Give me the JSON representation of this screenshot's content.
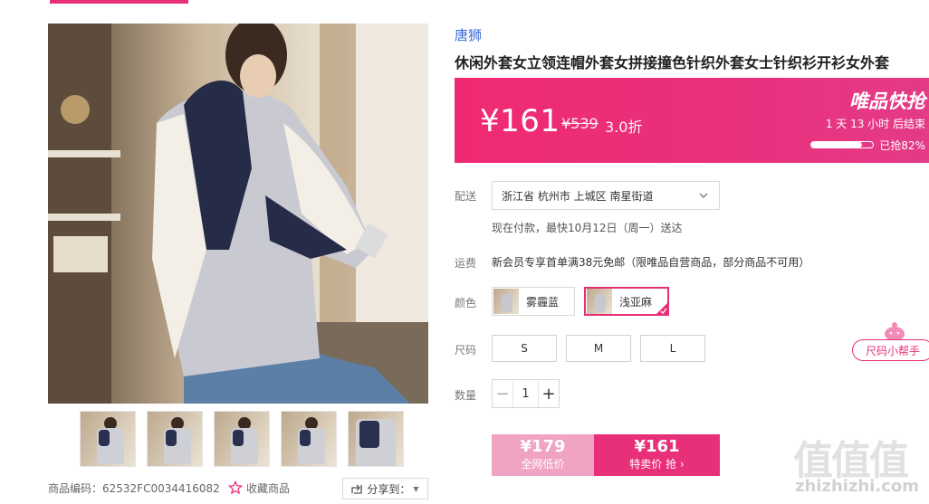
{
  "brand": "唐狮",
  "title": "休闲外套女立领连帽外套女拼接撞色针织外套女士针织衫开衫女外套",
  "price": {
    "current": "¥161",
    "original": "¥539",
    "discount": "3.0折",
    "promo_label": "唯品快抢",
    "countdown": "1 天 13 小时 后结束",
    "sold_label": "已抢82%",
    "sold_fraction": 0.82
  },
  "delivery": {
    "label": "配送",
    "address": "浙江省 杭州市 上城区 南星街道",
    "note": "现在付款，最快10月12日（周一）送达"
  },
  "freight": {
    "label": "运费",
    "text": "新会员专享首单满38元免邮（限唯品自营商品，部分商品不可用）"
  },
  "color": {
    "label": "颜色",
    "options": [
      {
        "name": "雾霾蓝",
        "selected": false
      },
      {
        "name": "浅亚麻",
        "selected": true
      }
    ]
  },
  "size": {
    "label": "尺码",
    "options": [
      "S",
      "M",
      "L"
    ]
  },
  "quantity": {
    "label": "数量",
    "value": "1"
  },
  "buy_low": {
    "price": "¥179",
    "label": "全网低价"
  },
  "buy_now": {
    "price": "¥161",
    "label": "特卖价 抢"
  },
  "size_helper": "尺码小帮手",
  "product_code": "商品编码：62532FC0034416082",
  "favorite": "收藏商品",
  "share": "分享到：",
  "watermark": {
    "glyphs": "值值值",
    "url": "zhizhizhi.com"
  },
  "colors": {
    "accent": "#e8307a",
    "brand_link": "#3a6bd6",
    "low_price": "#f0a3c3"
  }
}
